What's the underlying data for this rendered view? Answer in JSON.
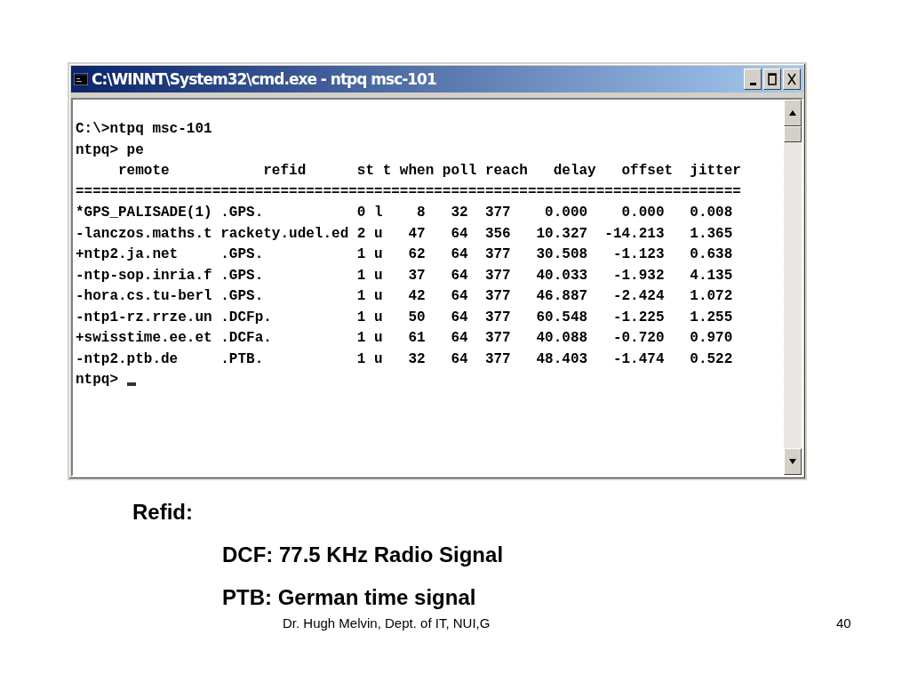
{
  "window": {
    "title": "C:\\WINNT\\System32\\cmd.exe - ntpq msc-101"
  },
  "console": {
    "lines": [
      "C:\\>ntpq msc-101",
      "ntpq> pe",
      "     remote           refid      st t when poll reach   delay   offset  jitter",
      "==============================================================================",
      "*GPS_PALISADE(1) .GPS.           0 l    8   32  377    0.000    0.000   0.008",
      "-lanczos.maths.t rackety.udel.ed 2 u   47   64  356   10.327  -14.213   1.365",
      "+ntp2.ja.net     .GPS.           1 u   62   64  377   30.508   -1.123   0.638",
      "-ntp-sop.inria.f .GPS.           1 u   37   64  377   40.033   -1.932   4.135",
      "-hora.cs.tu-berl .GPS.           1 u   42   64  377   46.887   -2.424   1.072",
      "-ntp1-rz.rrze.un .DCFp.          1 u   50   64  377   60.548   -1.225   1.255",
      "+swisstime.ee.et .DCFa.          1 u   61   64  377   40.088   -0.720   0.970",
      "-ntp2.ptb.de     .PTB.           1 u   32   64  377   48.403   -1.474   0.522"
    ],
    "prompt": "ntpq>"
  },
  "slide": {
    "heading": "Refid:",
    "points": [
      "DCF: 77.5 KHz Radio Signal",
      "PTB: German time signal"
    ],
    "footer": "Dr. Hugh Melvin, Dept. of IT, NUI,G",
    "page_number": "40"
  }
}
